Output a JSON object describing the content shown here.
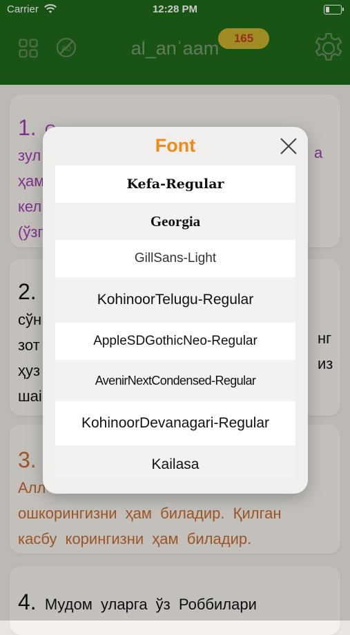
{
  "status_bar": {
    "carrier": "Carrier",
    "time": "12:28 PM"
  },
  "nav": {
    "title": "al_anʾaam",
    "count_badge": "165"
  },
  "cards": [
    {
      "number": "1.",
      "lines": [
        "С",
        "зул",
        "ҳам",
        "кел",
        "(ўзг"
      ],
      "right_fragment": "а",
      "color": "#9b3fb0"
    },
    {
      "number": "2.",
      "lines": [
        "сўн",
        "зот",
        "ҳуз",
        "шаі"
      ],
      "right_fragments": [
        "нг",
        "из"
      ],
      "color": "#111111"
    },
    {
      "number": "3.",
      "lines": [
        "Алл",
        "ошкорингизни ҳам биладир. Қилган",
        "касбу корингизни ҳам биладир."
      ],
      "color": "#c46a2e"
    },
    {
      "number": "4.",
      "lines": [
        "Мудом уларга ўз Роббилари"
      ],
      "color": "#111111"
    }
  ],
  "modal": {
    "title": "Font",
    "fonts": [
      "Kefa-Regular",
      "Georgia",
      "GillSans-Light",
      "KohinoorTelugu-Regular",
      "AppleSDGothicNeo-Regular",
      "AvenirNextCondensed-Regular",
      "KohinoorDevanagari-Regular",
      "Kailasa"
    ]
  },
  "colors": {
    "header_green": "#1f6b1a",
    "accent_orange": "#f08a16",
    "badge_yellow": "#c9b02c"
  },
  "icons": [
    "wifi-icon",
    "battery-icon",
    "grid-icon",
    "no-ads-icon",
    "gear-icon",
    "close-icon"
  ]
}
